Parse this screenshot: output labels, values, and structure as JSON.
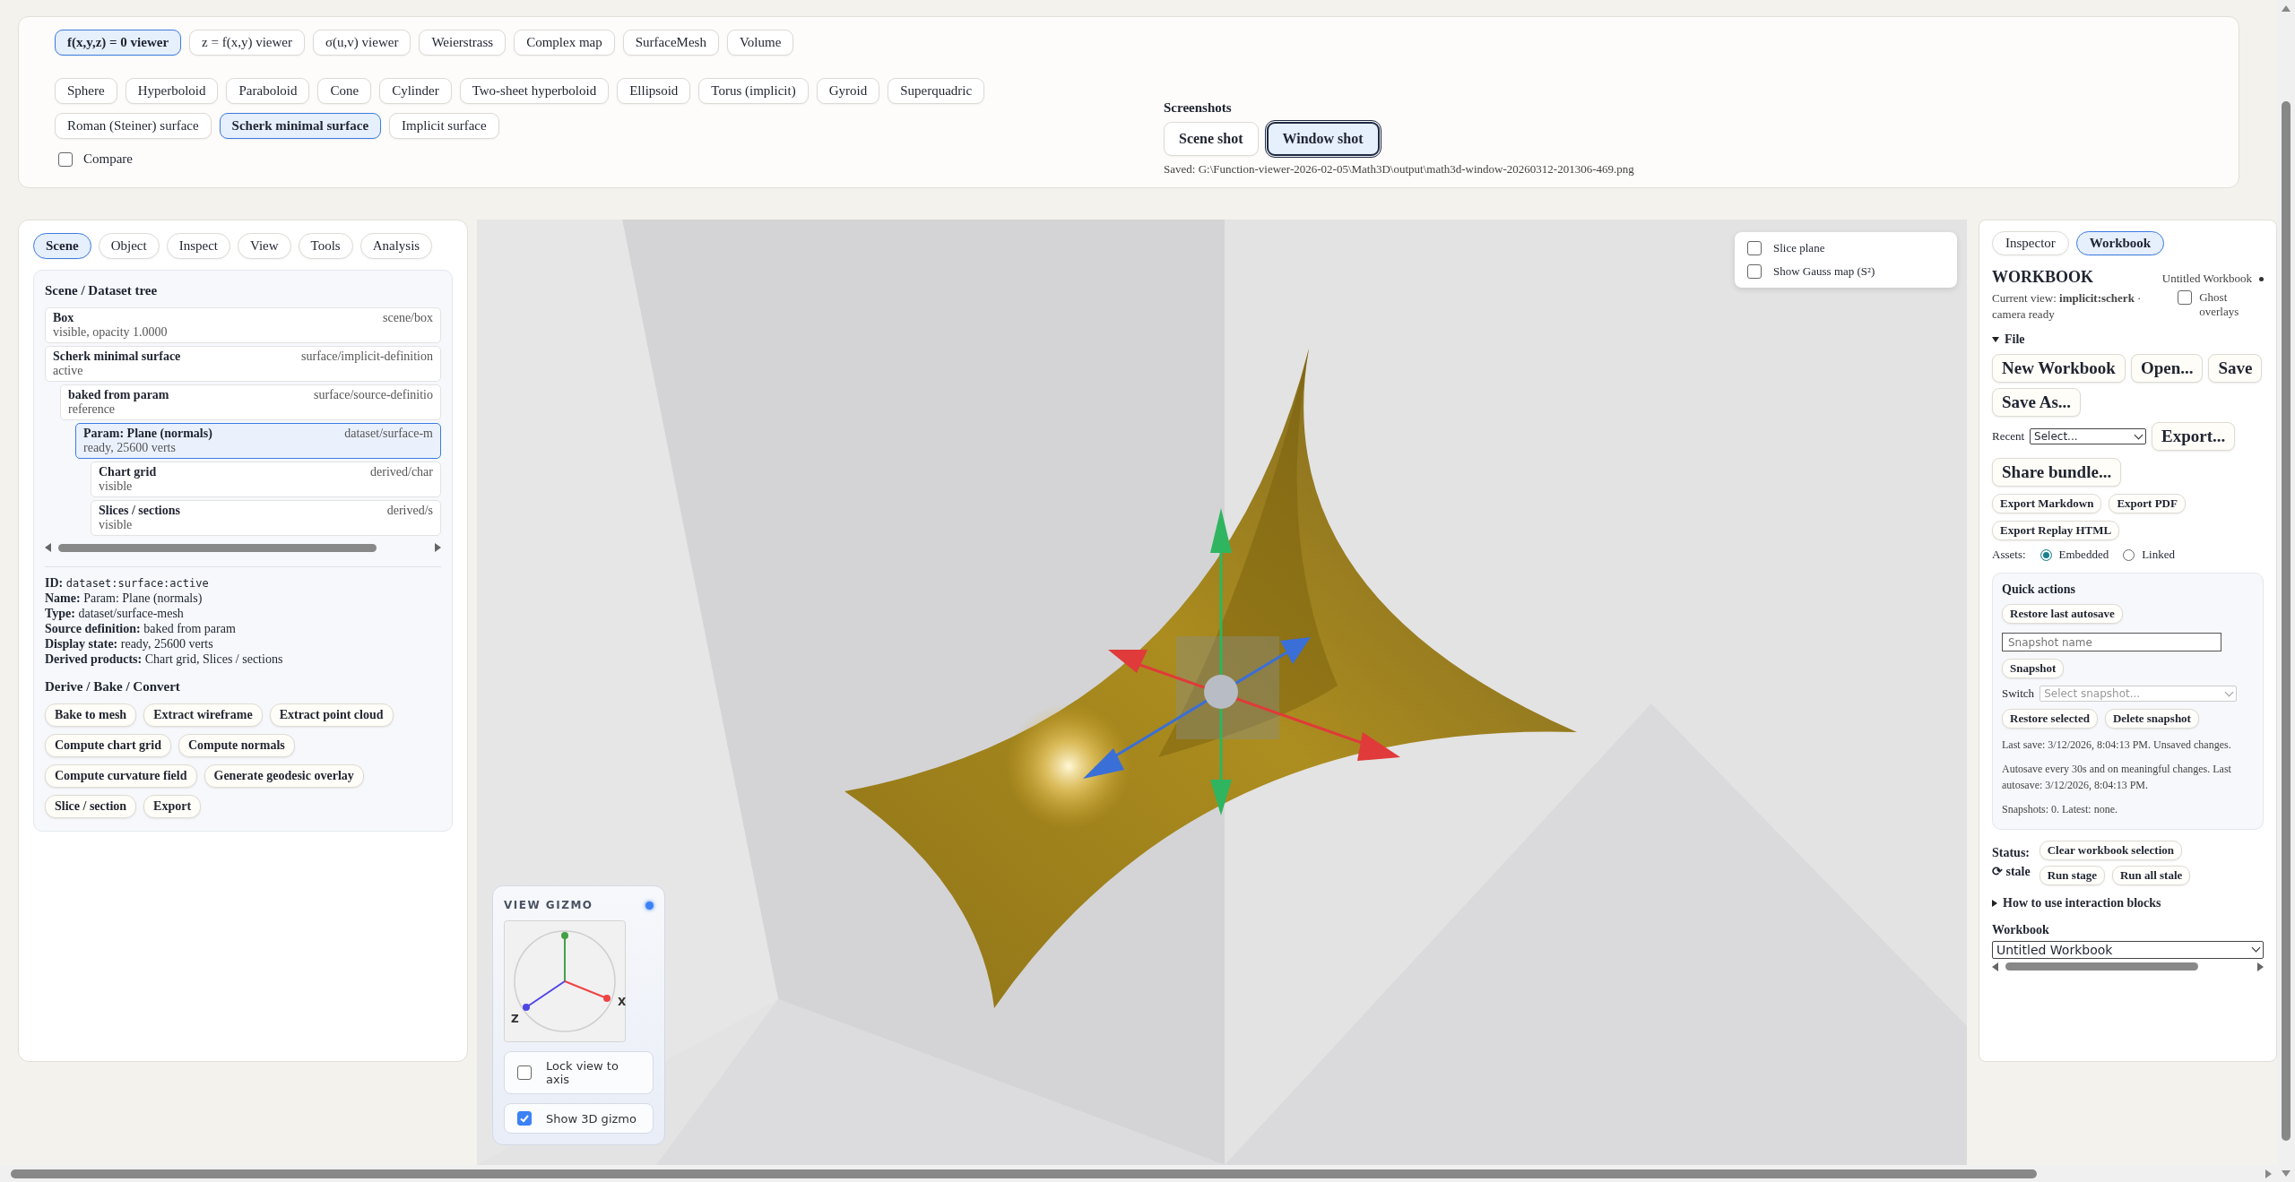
{
  "viewer_modes": [
    {
      "label": "f(x,y,z) = 0 viewer",
      "selected": true
    },
    {
      "label": "z = f(x,y) viewer",
      "selected": false
    },
    {
      "label": "σ(u,v) viewer",
      "selected": false
    },
    {
      "label": "Weierstrass",
      "selected": false
    },
    {
      "label": "Complex map",
      "selected": false
    },
    {
      "label": "SurfaceMesh",
      "selected": false
    },
    {
      "label": "Volume",
      "selected": false
    }
  ],
  "surfaces": [
    {
      "label": "Sphere",
      "selected": false
    },
    {
      "label": "Hyperboloid",
      "selected": false
    },
    {
      "label": "Paraboloid",
      "selected": false
    },
    {
      "label": "Cone",
      "selected": false
    },
    {
      "label": "Cylinder",
      "selected": false
    },
    {
      "label": "Two-sheet hyperboloid",
      "selected": false
    },
    {
      "label": "Ellipsoid",
      "selected": false
    },
    {
      "label": "Torus (implicit)",
      "selected": false
    },
    {
      "label": "Gyroid",
      "selected": false
    },
    {
      "label": "Superquadric",
      "selected": false
    },
    {
      "label": "Roman (Steiner) surface",
      "selected": false
    },
    {
      "label": "Scherk minimal surface",
      "selected": true
    },
    {
      "label": "Implicit surface",
      "selected": false
    }
  ],
  "compare": {
    "label": "Compare",
    "checked": false
  },
  "screenshots": {
    "title": "Screenshots",
    "buttons": [
      {
        "label": "Scene shot",
        "selected": false
      },
      {
        "label": "Window shot",
        "selected": true
      }
    ],
    "saved": "Saved: G:\\Function-viewer-2026-02-05\\Math3D\\output\\math3d-window-20260312-201306-469.png"
  },
  "left_panel": {
    "tabs": [
      {
        "label": "Scene",
        "selected": true
      },
      {
        "label": "Object",
        "selected": false
      },
      {
        "label": "Inspect",
        "selected": false
      },
      {
        "label": "View",
        "selected": false
      },
      {
        "label": "Tools",
        "selected": false
      },
      {
        "label": "Analysis",
        "selected": false
      }
    ],
    "tree": {
      "title": "Scene / Dataset tree",
      "nodes": [
        {
          "name": "Box",
          "type": "scene/box",
          "state": "visible, opacity 1.0000",
          "selected": false
        },
        {
          "name": "Scherk minimal surface",
          "type": "surface/implicit-definition",
          "state": "active",
          "selected": false,
          "children": [
            {
              "name": "baked from param",
              "type": "surface/source-definitio",
              "state": "reference",
              "selected": false,
              "children": [
                {
                  "name": "Param: Plane (normals)",
                  "type": "dataset/surface-m",
                  "state": "ready, 25600 verts",
                  "selected": true,
                  "children": [
                    {
                      "name": "Chart grid",
                      "type": "derived/char",
                      "state": "visible",
                      "selected": false
                    },
                    {
                      "name": "Slices / sections",
                      "type": "derived/s",
                      "state": "visible",
                      "selected": false
                    }
                  ]
                }
              ]
            }
          ]
        }
      ]
    },
    "details": [
      {
        "label": "ID:",
        "value": "dataset:surface:active",
        "kind": "code"
      },
      {
        "label": "Name:",
        "value": "Param: Plane (normals)",
        "kind": "text"
      },
      {
        "label": "Type:",
        "value": "dataset/surface-mesh",
        "kind": "text"
      },
      {
        "label": "Source definition:",
        "value": "baked from param",
        "kind": "text"
      },
      {
        "label": "Display state:",
        "value": "ready, 25600 verts",
        "kind": "text"
      },
      {
        "label": "Derived products:",
        "value": "Chart grid, Slices / sections",
        "kind": "text"
      }
    ],
    "derive": {
      "title": "Derive / Bake / Convert",
      "buttons": [
        "Bake to mesh",
        "Extract wireframe",
        "Extract point cloud",
        "Compute chart grid",
        "Compute normals",
        "Compute curvature field",
        "Generate geodesic overlay",
        "Slice / section",
        "Export"
      ]
    }
  },
  "viewport": {
    "options": [
      {
        "label": "Slice plane",
        "checked": false
      },
      {
        "label": "Show Gauss map (S²)",
        "checked": false
      }
    ],
    "gizmo": {
      "title": "VIEW GIZMO",
      "axis_labels": [
        "X",
        "Z"
      ],
      "options": [
        {
          "label": "Lock view to axis",
          "checked": false
        },
        {
          "label": "Show 3D gizmo",
          "checked": true
        }
      ]
    }
  },
  "right_panel": {
    "tabs": [
      {
        "label": "Inspector",
        "selected": false
      },
      {
        "label": "Workbook",
        "selected": true
      }
    ],
    "heading": "WORKBOOK",
    "workbook_name": "Untitled Workbook",
    "unsaved": true,
    "current_view": "Current view: **implicit:scherk** · camera ready",
    "ghost_overlays": {
      "label": "Ghost overlays",
      "checked": false
    },
    "file": {
      "label": "File",
      "expanded": true,
      "buttons": [
        "New Workbook",
        "Open...",
        "Save",
        "Save As..."
      ],
      "recent": {
        "label": "Recent",
        "value": "Select..."
      },
      "export_button": "Export...",
      "share_button": "Share bundle...",
      "export_buttons": [
        "Export Markdown",
        "Export PDF",
        "Export Replay HTML"
      ],
      "assets": {
        "label": "Assets:",
        "options": [
          {
            "label": "Embedded",
            "selected": true
          },
          {
            "label": "Linked",
            "selected": false
          }
        ]
      }
    },
    "quick_actions": {
      "title": "Quick actions",
      "restore_button": "Restore last autosave",
      "snapshot_name": {
        "placeholder": "Snapshot name"
      },
      "snapshot_button": "Snapshot",
      "switch": {
        "label": "Switch",
        "value": "Select snapshot...",
        "disabled": true
      },
      "buttons": [
        "Restore selected",
        "Delete snapshot"
      ],
      "notes": [
        "Last save: 3/12/2026, 8:04:13 PM. Unsaved changes.",
        "Autosave every 30s and on meaningful changes. Last autosave: 3/12/2026, 8:04:13 PM.",
        "Snapshots: 0. Latest: none."
      ]
    },
    "status": {
      "label": "Status:",
      "state": "⟳ stale",
      "buttons": [
        "Clear workbook selection",
        "Run stage",
        "Run all stale"
      ]
    },
    "help": {
      "label": "How to use interaction blocks",
      "expanded": false
    },
    "workbook_select": {
      "label": "Workbook",
      "value": "Untitled Workbook"
    }
  }
}
